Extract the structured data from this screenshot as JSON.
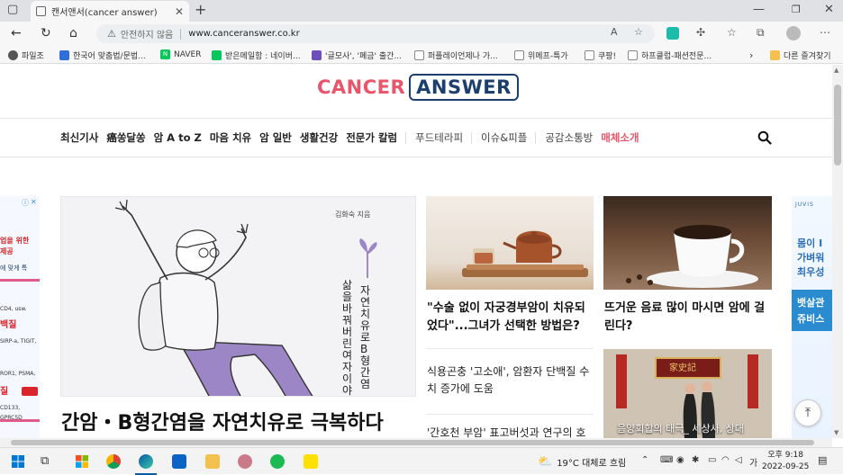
{
  "browser": {
    "tab_title": "캔서앤서(cancer answer)",
    "security_label": "안전하지 않음",
    "url": "www.canceranswer.co.kr",
    "bookmarks": [
      {
        "label": "파일조",
        "color": "#555"
      },
      {
        "label": "한국어 맞춤법/문법...",
        "color": "#2f6fd6"
      },
      {
        "label": "NAVER",
        "color": "#03c75a"
      },
      {
        "label": "받은메일함 : 네이버...",
        "color": "#03c75a"
      },
      {
        "label": "'글모사', '폐금' 출간...",
        "color": "#6b4fbb"
      },
      {
        "label": "퍼플레이언제나 가...",
        "color": "#888"
      },
      {
        "label": "위메프-특가",
        "color": "#888"
      },
      {
        "label": "쿠팡!",
        "color": "#888"
      },
      {
        "label": "하프클럽-패션전문...",
        "color": "#888"
      }
    ],
    "other_bookmarks": "다른 즐겨찾기"
  },
  "site": {
    "logo_part1": "CANCER",
    "logo_part2": "ANSWER",
    "nav": {
      "primary": [
        "최신기사",
        "癌쏭달쏭",
        "암 A to Z",
        "마음 치유",
        "암 일반",
        "생활건강",
        "전문가 칼럼"
      ],
      "secondary": [
        "푸드테라피",
        "이슈&피플",
        "공감소통방"
      ],
      "accent": "매체소개"
    },
    "hero": {
      "title": "간암・B형간염을 자연치유로 극복하다",
      "book_author": "김화숙 지음",
      "book_title_col1": "자연치유로 B형 간염",
      "book_title_col2": "삶을 바꿔버린 여자 이야기"
    },
    "articles": [
      {
        "title": "\"수술 없이 자궁경부암이 치유되었다\"...그녀가 선택한 방법은?"
      },
      {
        "title": "뜨거운 음료 많이 마시면 암에 걸린다?"
      },
      {
        "title": "식용곤충 '고소애', 암환자 단백질 수치 증가에 도움"
      },
      {
        "title": "'간호천 부암' 표고버섯과 연구의 호"
      },
      {
        "title": "음양회합의 태극_ 세상사, 상대"
      }
    ],
    "ad_left": {
      "lines": [
        "업을 위한",
        "제공",
        "에 맞게 특",
        "CD4, usw.",
        "백질",
        "SIRP-a, TIGIT,",
        "ROR1, PSMA,",
        "질",
        "CD133, GPRC5D"
      ]
    },
    "ad_right": {
      "brand": "JUVIS",
      "lines": [
        "몸이 I",
        "가벼워",
        "최우성",
        "뱃살관",
        "쥬비스"
      ]
    },
    "painting_text": "家史記"
  },
  "taskbar": {
    "weather": "19°C 대체로 흐림",
    "time": "오후 9:18",
    "date": "2022-09-25"
  }
}
